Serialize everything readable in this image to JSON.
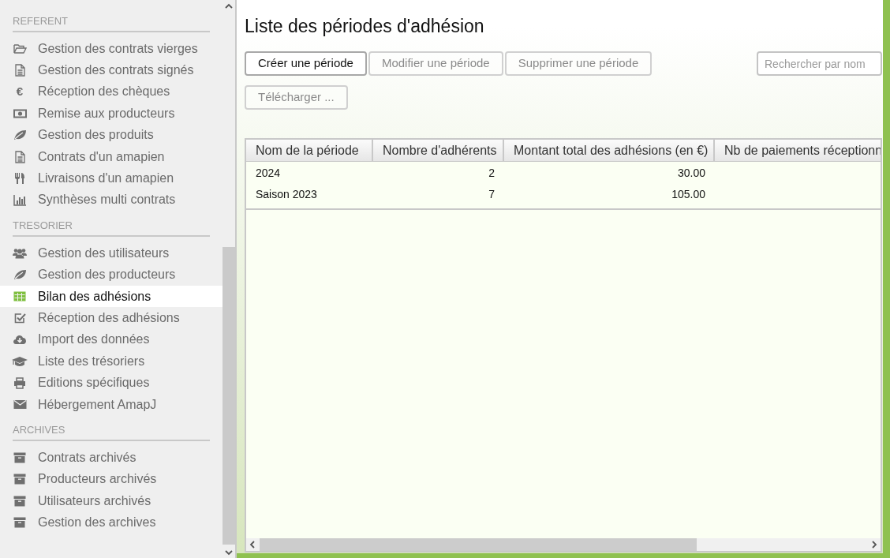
{
  "sidebar": {
    "sections": [
      {
        "title": "REFERENT",
        "items": [
          {
            "label": "Gestion des contrats vierges",
            "kind": "folder",
            "selected": false
          },
          {
            "label": "Gestion des contrats signés",
            "kind": "file",
            "selected": false
          },
          {
            "label": "Réception des chèques",
            "kind": "char",
            "icon_text": "€",
            "selected": false
          },
          {
            "label": "Remise aux producteurs",
            "kind": "money",
            "selected": false
          },
          {
            "label": "Gestion des produits",
            "kind": "leaf",
            "selected": false
          },
          {
            "label": "Contrats d'un amapien",
            "kind": "file",
            "selected": false
          },
          {
            "label": "Livraisons d'un amapien",
            "kind": "utensils",
            "selected": false
          },
          {
            "label": "Synthèses multi contrats",
            "kind": "chart",
            "selected": false
          }
        ]
      },
      {
        "title": "TRESORIER",
        "items": [
          {
            "label": "Gestion des utilisateurs",
            "kind": "users",
            "selected": false
          },
          {
            "label": "Gestion des producteurs",
            "kind": "leaf",
            "selected": false
          },
          {
            "label": "Bilan des adhésions",
            "kind": "table",
            "selected": true
          },
          {
            "label": "Réception des adhésions",
            "kind": "check",
            "selected": false
          },
          {
            "label": "Import des données",
            "kind": "cloud",
            "selected": false
          },
          {
            "label": "Liste des trésoriers",
            "kind": "cap",
            "selected": false
          },
          {
            "label": "Editions spécifiques",
            "kind": "printer",
            "selected": false
          },
          {
            "label": "Hébergement AmapJ",
            "kind": "envelope",
            "selected": false
          }
        ]
      },
      {
        "title": "ARCHIVES",
        "items": [
          {
            "label": "Contrats archivés",
            "kind": "archive",
            "selected": false
          },
          {
            "label": "Producteurs archivés",
            "kind": "archive",
            "selected": false
          },
          {
            "label": "Utilisateurs archivés",
            "kind": "archive",
            "selected": false
          },
          {
            "label": "Gestion des archives",
            "kind": "archive",
            "selected": false
          }
        ]
      }
    ]
  },
  "page": {
    "title": "Liste des périodes d'adhésion",
    "buttons": [
      {
        "label": "Créer une période",
        "disabled": false
      },
      {
        "label": "Modifier une période",
        "disabled": true
      },
      {
        "label": "Supprimer une période",
        "disabled": true
      }
    ],
    "search": {
      "placeholder": "Rechercher par nom"
    },
    "download_button": {
      "label": "Télécharger ...",
      "disabled": true
    }
  },
  "table": {
    "columns": [
      "Nom de la période",
      "Nombre d'adhérents",
      "Montant total des adhésions (en €)",
      "Nb de paiements réceptionn"
    ],
    "rows": [
      [
        "2024",
        "2",
        "30.00"
      ],
      [
        "Saison 2023",
        "7",
        "105.00"
      ]
    ]
  }
}
